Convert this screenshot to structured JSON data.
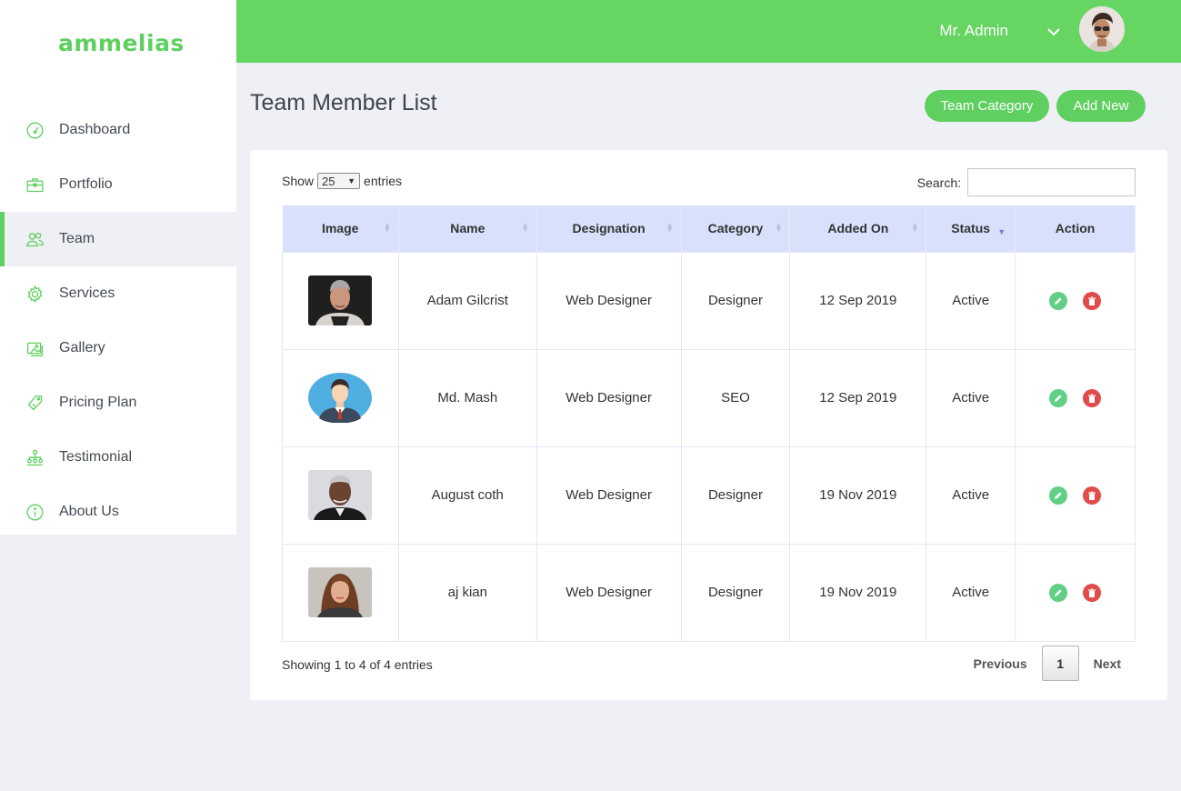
{
  "brand": {
    "name": "ammelias",
    "accent": "#5fcf5f",
    "topbar_color": "#66d562"
  },
  "sidebar": {
    "items": [
      {
        "label": "Dashboard",
        "icon": "dashboard-gauge-icon",
        "active": false
      },
      {
        "label": "Portfolio",
        "icon": "briefcase-icon",
        "active": false
      },
      {
        "label": "Team",
        "icon": "users-icon",
        "active": true
      },
      {
        "label": "Services",
        "icon": "gear-icon",
        "active": false
      },
      {
        "label": "Gallery",
        "icon": "image-icon",
        "active": false
      },
      {
        "label": "Pricing Plan",
        "icon": "price-tag-icon",
        "active": false
      },
      {
        "label": "Testimonial",
        "icon": "org-chart-icon",
        "active": false
      },
      {
        "label": "About Us",
        "icon": "info-icon",
        "active": false
      }
    ]
  },
  "header": {
    "user_name": "Mr. Admin",
    "dropdown_icon": "chevron-down-icon"
  },
  "page": {
    "title": "Team Member List",
    "buttons": {
      "team_category": "Team Category",
      "add_new": "Add New"
    }
  },
  "table_controls": {
    "show_label": "Show",
    "entries_value": "25",
    "entries_label": "entries",
    "search_label": "Search:",
    "search_value": ""
  },
  "table": {
    "columns": [
      "Image",
      "Name",
      "Designation",
      "Category",
      "Added On",
      "Status",
      "Action"
    ],
    "rows": [
      {
        "image": "portrait-older-man",
        "name": "Adam Gilcrist",
        "designation": "Web Designer",
        "category": "Designer",
        "added_on": "12 Sep 2019",
        "status": "Active"
      },
      {
        "image": "avatar-illustration",
        "name": "Md. Mash",
        "designation": "Web Designer",
        "category": "SEO",
        "added_on": "12 Sep 2019",
        "status": "Active"
      },
      {
        "image": "portrait-man-gray-hair",
        "name": "August coth",
        "designation": "Web Designer",
        "category": "Designer",
        "added_on": "19 Nov 2019",
        "status": "Active"
      },
      {
        "image": "portrait-woman",
        "name": "aj kian",
        "designation": "Web Designer",
        "category": "Designer",
        "added_on": "19 Nov 2019",
        "status": "Active"
      }
    ]
  },
  "footer": {
    "showing": "Showing 1 to 4 of 4 entries",
    "previous": "Previous",
    "current_page": "1",
    "next": "Next"
  }
}
